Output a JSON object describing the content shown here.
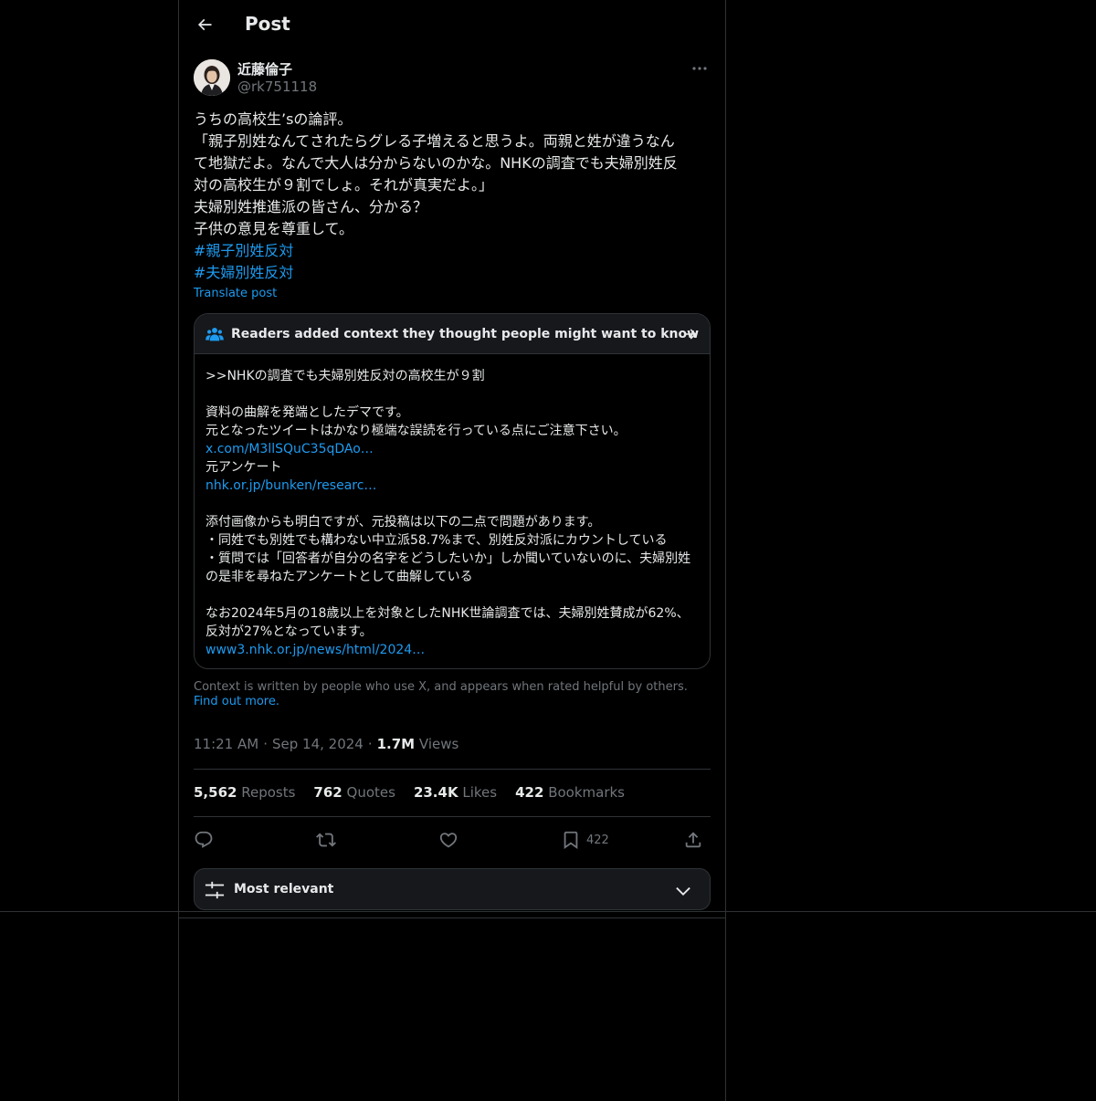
{
  "header": {
    "title": "Post"
  },
  "author": {
    "display_name": "近藤倫子",
    "handle": "@rk751118"
  },
  "post": {
    "lines": [
      "うちの高校生’sの論評。",
      "「親子別姓なんてされたらグレる子増えると思うよ。両親と姓が違うなん",
      "て地獄だよ。なんで大人は分からないのかな。NHKの調査でも夫婦別姓反",
      "対の高校生が９割でしょ。それが真実だよ。」",
      "夫婦別姓推進派の皆さん、分かる？",
      "子供の意見を尊重して。"
    ],
    "hashtags": [
      "#親子別姓反対",
      "#夫婦別姓反対"
    ],
    "translate_label": "Translate post"
  },
  "community_note": {
    "header": "Readers added context they thought people might want to know",
    "quote": ">>NHKの調査でも夫婦別姓反対の高校生が９割",
    "line1": "資料の曲解を発端としたデマです。",
    "line2": "元となったツイートはかなり極端な誤読を行っている点にご注意下さい。",
    "link1": "x.com/M3llSQuC35qDAo…",
    "line3": "元アンケート",
    "link2": "nhk.or.jp/bunken/researc…",
    "line4": "添付画像からも明白ですが、元投稿は以下の二点で問題があります。",
    "line5": "・同姓でも別姓でも構わない中立派58.7%まで、別姓反対派にカウントしている",
    "line6": "・質問では「回答者が自分の名字をどうしたいか」しか聞いていないのに、夫婦別姓の是非を尋ねたアンケートとして曲解している",
    "line7": "なお2024年5月の18歳以上を対象としたNHK世論調査では、夫婦別姓賛成が62%、反対が27%となっています。",
    "link3": "www3.nhk.or.jp/news/html/2024…"
  },
  "context_footer": {
    "text": "Context is written by people who use X, and appears when rated helpful by others.",
    "link": "Find out more."
  },
  "meta": {
    "time": "11:21 AM",
    "date": "Sep 14, 2024",
    "views_count": "1.7M",
    "views_label": "Views"
  },
  "stats": {
    "reposts_count": "5,562",
    "reposts_label": "Reposts",
    "quotes_count": "762",
    "quotes_label": "Quotes",
    "likes_count": "23.4K",
    "likes_label": "Likes",
    "bookmarks_count": "422",
    "bookmarks_label": "Bookmarks"
  },
  "actions": {
    "bookmark_count": "422"
  },
  "sort": {
    "label": "Most relevant"
  },
  "colors": {
    "accent": "#1d9bf0",
    "background": "#000000",
    "muted": "#71767b",
    "border": "#2f3336"
  }
}
